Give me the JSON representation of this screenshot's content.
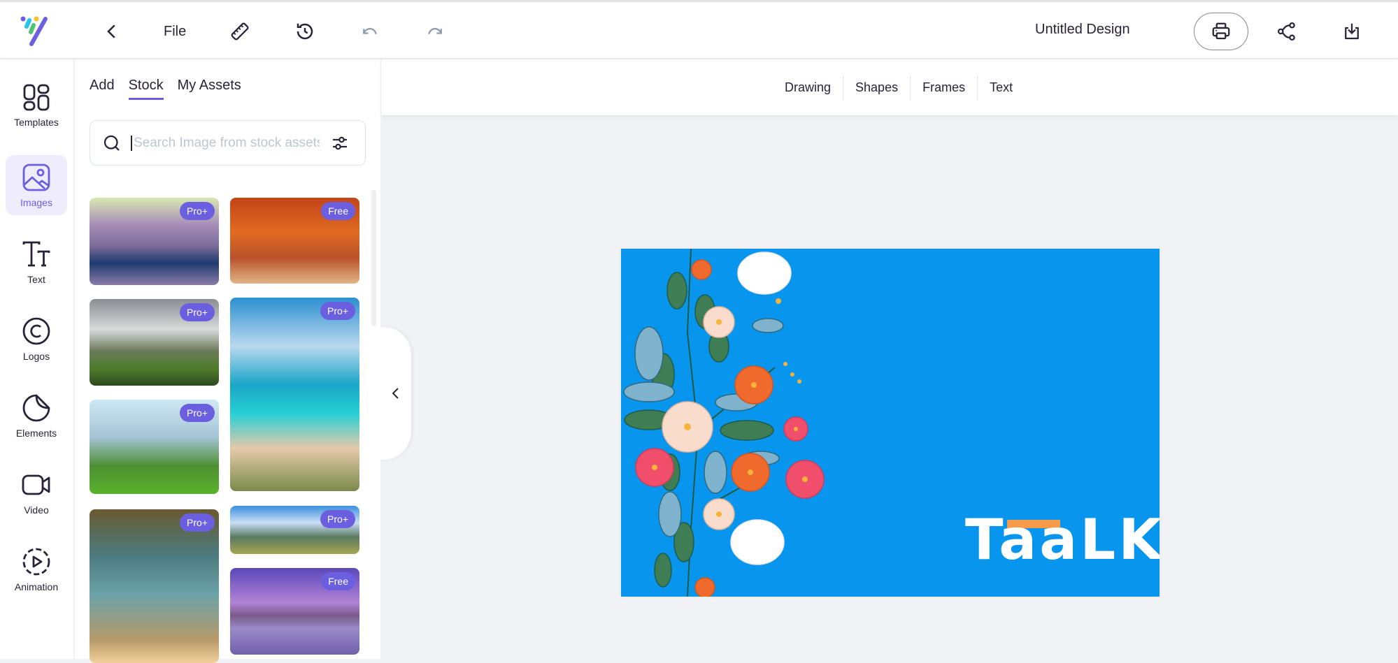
{
  "topbar": {
    "logo": "app-logo",
    "back_icon": "chevron-left-icon",
    "file_label": "File",
    "ruler_icon": "ruler-icon",
    "history_icon": "history-icon",
    "undo_icon": "undo-icon",
    "redo_icon": "redo-icon",
    "title": "Untitled Design",
    "print_icon": "printer-icon",
    "share_icon": "share-icon",
    "download_icon": "download-icon"
  },
  "sidebar": {
    "items": [
      {
        "label": "Templates",
        "icon": "templates-icon",
        "active": false
      },
      {
        "label": "Images",
        "icon": "image-icon",
        "active": true
      },
      {
        "label": "Text",
        "icon": "text-icon",
        "active": false
      },
      {
        "label": "Logos",
        "icon": "copyright-icon",
        "active": false
      },
      {
        "label": "Elements",
        "icon": "sticker-icon",
        "active": false
      },
      {
        "label": "Video",
        "icon": "video-icon",
        "active": false
      },
      {
        "label": "Animation",
        "icon": "play-circle-icon",
        "active": false
      }
    ]
  },
  "panel": {
    "tabs": [
      {
        "label": "Add",
        "active": false
      },
      {
        "label": "Stock",
        "active": true
      },
      {
        "label": "My Assets",
        "active": false
      }
    ],
    "search": {
      "placeholder": "Search Image from stock assets",
      "value": ""
    },
    "images": [
      {
        "desc": "Purple rocky lake",
        "badge": "Pro+"
      },
      {
        "desc": "Autumn forest path",
        "badge": "Free"
      },
      {
        "desc": "Green hills cloudy sky",
        "badge": "Pro+"
      },
      {
        "desc": "Turquoise beach cove",
        "badge": "Pro+"
      },
      {
        "desc": "City skyline park",
        "badge": "Pro+"
      },
      {
        "desc": "Palm trees sunset",
        "badge": "Pro+"
      },
      {
        "desc": "Mountain lake valley",
        "badge": "Pro+"
      },
      {
        "desc": "Lone tree in purple lake",
        "badge": "Free"
      }
    ],
    "collapse_icon": "chevron-left-icon"
  },
  "subtoolbar": {
    "tabs": [
      "Drawing",
      "Shapes",
      "Frames",
      "Text"
    ]
  },
  "canvas": {
    "background": "#0795ee",
    "brand_text": "TaaLK",
    "accent": "#f79a4a"
  },
  "colors": {
    "accent": "#6b5fe0"
  }
}
